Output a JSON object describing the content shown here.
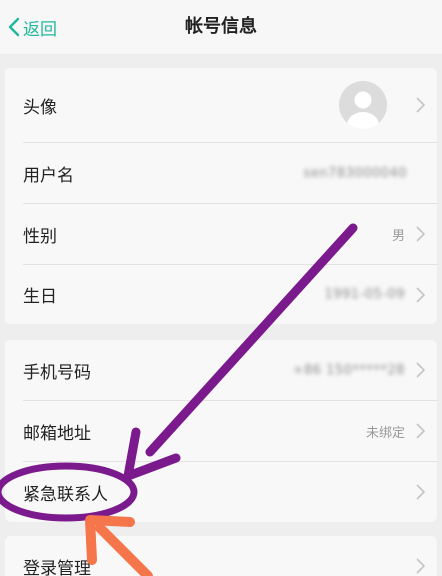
{
  "navbar": {
    "back_label": "返回",
    "title": "帐号信息"
  },
  "account": {
    "avatar_label": "头像",
    "username_label": "用户名",
    "username_value": "sen783000040",
    "gender_label": "性别",
    "gender_value": "男",
    "birthday_label": "生日",
    "birthday_value": "1991-05-09"
  },
  "contact": {
    "phone_label": "手机号码",
    "phone_value": "+86 150*****28",
    "email_label": "邮箱地址",
    "email_value": "未绑定",
    "emergency_label": "紧急联系人"
  },
  "security": {
    "login_label": "登录管理"
  },
  "colors": {
    "accent": "#1fb89c",
    "annotation_purple": "#7b1a8c",
    "annotation_orange": "#f4764a"
  },
  "icons": {
    "back": "chevron-left-icon",
    "row": "chevron-right-icon",
    "avatar": "user-silhouette-icon"
  }
}
